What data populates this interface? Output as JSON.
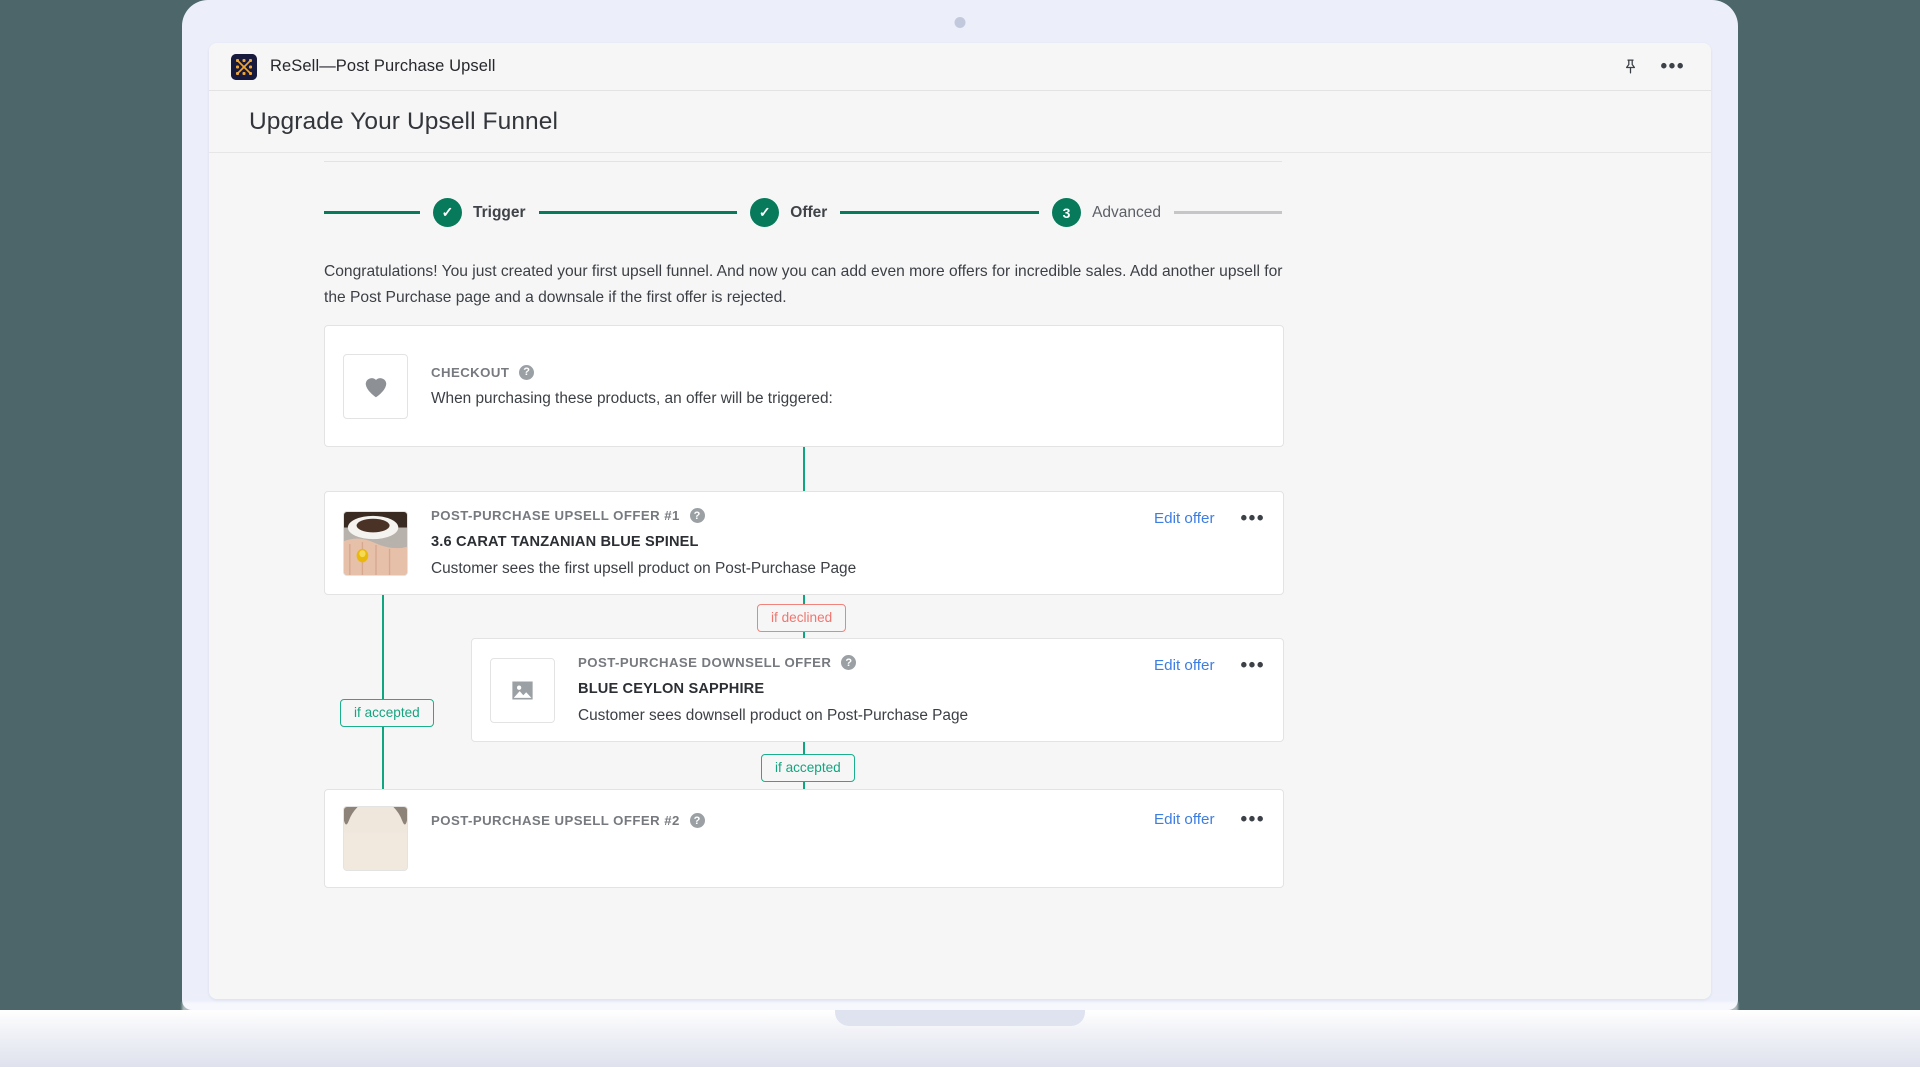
{
  "window": {
    "app_title": "ReSell—Post Purchase Upsell",
    "pin_icon": "pin-icon",
    "more_icon": "•••"
  },
  "page": {
    "title": "Upgrade Your Upsell Funnel",
    "intro": "Congratulations! You just created your first upsell funnel. And now you can add even more offers for incredible sales. Add another upsell for the Post Purchase page and a downsale if the first offer is rejected."
  },
  "stepper": {
    "steps": [
      {
        "badge": "✓",
        "label": "Trigger",
        "state": "complete"
      },
      {
        "badge": "✓",
        "label": "Offer",
        "state": "complete"
      },
      {
        "badge": "3",
        "label": "Advanced",
        "state": "current"
      }
    ],
    "accent_color": "#067a5b",
    "inactive_color": "#c6c6c8"
  },
  "flow": {
    "help_glyph": "?",
    "edit_label": "Edit offer",
    "menu_glyph": "•••",
    "cards": [
      {
        "eyebrow": "CHECKOUT",
        "product": "",
        "desc": "When purchasing these products, an offer will be triggered:",
        "thumb": "heart-icon",
        "has_actions": false
      },
      {
        "eyebrow": "POST-PURCHASE UPSELL OFFER #1",
        "product": "3.6 CARAT TANZANIAN BLUE SPINEL",
        "desc": "Customer sees the first upsell product on Post-Purchase Page",
        "thumb": "product-photo-ring",
        "has_actions": true
      },
      {
        "eyebrow": "POST-PURCHASE DOWNSELL OFFER",
        "product": "BLUE CEYLON SAPPHIRE",
        "desc": "Customer sees downsell product on Post-Purchase Page",
        "thumb": "image-placeholder-icon",
        "has_actions": true
      },
      {
        "eyebrow": "POST-PURCHASE UPSELL OFFER #2",
        "product": "",
        "desc": "",
        "thumb": "product-photo-skin",
        "has_actions": true
      }
    ],
    "badges": {
      "declined": "if declined",
      "accepted": "if accepted",
      "accepted2": "if accepted"
    },
    "colors": {
      "accepted": "#15a47f",
      "declined": "#f0766f",
      "link": "#3d7ee3",
      "connector": "#0fa57e"
    }
  }
}
